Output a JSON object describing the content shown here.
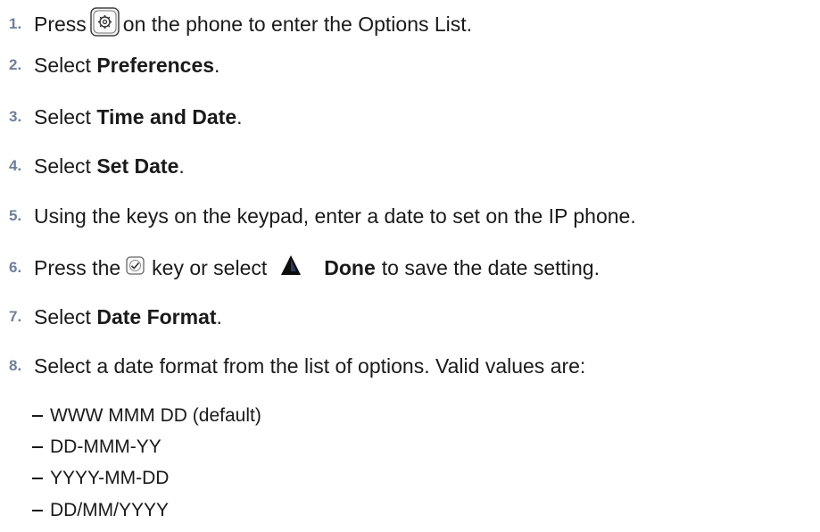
{
  "steps": [
    {
      "num": "1.",
      "pre": "Press",
      "post": "on the phone to enter the Options List.",
      "icon": "options-key-icon"
    },
    {
      "num": "2.",
      "pre": "Select ",
      "bold": "Preferences",
      "post": "."
    },
    {
      "num": "3.",
      "pre": "Select ",
      "bold": "Time and Date",
      "post": "."
    },
    {
      "num": "4.",
      "pre": "Select ",
      "bold": "Set Date",
      "post": "."
    },
    {
      "num": "5.",
      "pre": "Using the keys on the keypad, enter a date to set on the IP phone."
    },
    {
      "num": "6.",
      "pre": "Press the",
      "mid": "key or select",
      "bold": "Done",
      "post": "to save the date setting.",
      "icons": [
        "checkmark-key-icon",
        "up-triangle-softkey-icon"
      ]
    },
    {
      "num": "7.",
      "pre": "Select ",
      "bold": "Date Format",
      "post": "."
    },
    {
      "num": "8.",
      "pre": "Select a date format from the list of options. Valid values are:"
    }
  ],
  "date_formats": [
    "WWW MMM DD (default)",
    "DD-MMM-YY",
    "YYYY-MM-DD",
    "DD/MM/YYYY"
  ],
  "colors": {
    "step_number": "#6e7f99",
    "text": "#1a1a1a"
  }
}
